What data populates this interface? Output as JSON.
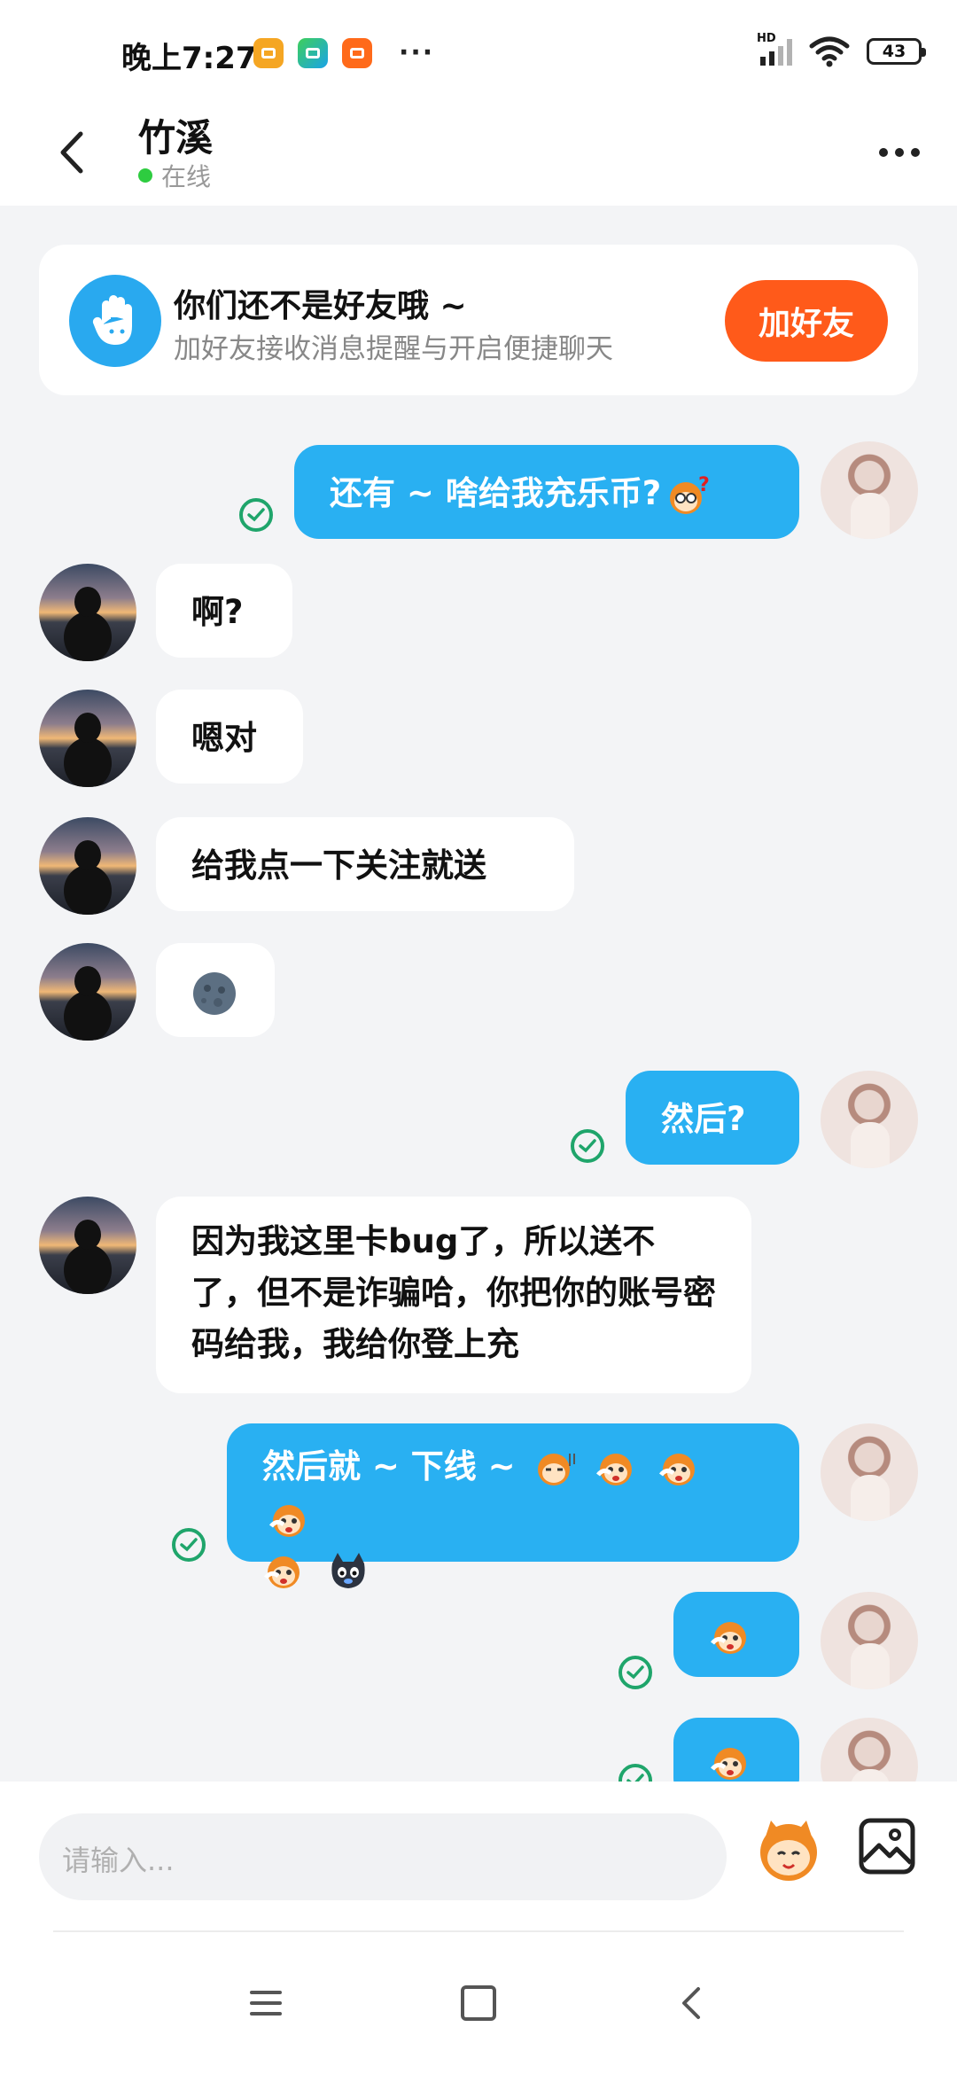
{
  "status_bar": {
    "time": "晚上7:27",
    "more": "···",
    "network": "HD",
    "battery": "43"
  },
  "header": {
    "contact_name": "竹溪",
    "status": "在线"
  },
  "friend_card": {
    "title": "你们还不是好友哦 ~",
    "subtitle": "加好友接收消息提醒与开启便捷聊天",
    "button": "加好友"
  },
  "messages": [
    {
      "sender": "me",
      "text": "还有 ~ 啥给我充乐币?",
      "emojis": [
        "monkey-confused-icon"
      ],
      "read": true
    },
    {
      "sender": "other",
      "text": "啊?"
    },
    {
      "sender": "other",
      "text": "嗯对"
    },
    {
      "sender": "other",
      "text": "给我点一下关注就送"
    },
    {
      "sender": "other",
      "emojis": [
        "new-moon-face-emoji"
      ]
    },
    {
      "sender": "me",
      "text": "然后?",
      "read": true
    },
    {
      "sender": "other",
      "text": "因为我这里卡bug了，所以送不了，但不是诈骗哈，你把你的账号密码给我，我给你登上充"
    },
    {
      "sender": "me",
      "text": "然后就 ~ 下线 ~",
      "emojis": [
        "monkey-sweat-icon",
        "monkey-slap-icon",
        "monkey-slap-icon",
        "monkey-slap-icon",
        "monkey-slap-icon",
        "black-cat-icon"
      ],
      "read": true
    },
    {
      "sender": "me",
      "emojis": [
        "monkey-slap-icon"
      ],
      "read": true
    },
    {
      "sender": "me",
      "emojis": [
        "monkey-slap-icon"
      ],
      "read": true
    }
  ],
  "input": {
    "placeholder": "请输入..."
  },
  "colors": {
    "accent_blue": "#29b0f2",
    "add_friend_orange": "#ff5a1a",
    "online_green": "#2ecc40",
    "read_check_green": "#1fa56b",
    "background": "#f3f4f6"
  }
}
